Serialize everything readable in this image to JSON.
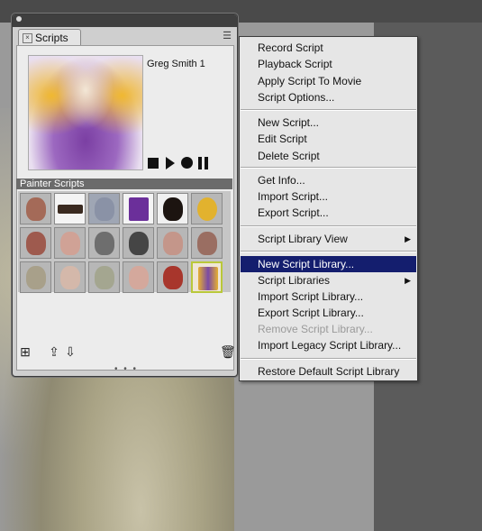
{
  "panel": {
    "tab_label": "Scripts",
    "close_glyph": "×",
    "menu_glyph": "☰",
    "preview_name": "Greg Smith 1",
    "library_header": "Painter Scripts",
    "bottom_glyphs": {
      "new_script": "⊞",
      "import": "⇪",
      "export": "⇩",
      "delete": "🗑"
    },
    "resize_dots": "• • •"
  },
  "menu": {
    "items": [
      {
        "label": "Record Script",
        "enabled": true
      },
      {
        "label": "Playback Script",
        "enabled": true
      },
      {
        "label": "Apply Script To Movie",
        "enabled": true
      },
      {
        "label": "Script Options...",
        "enabled": true
      },
      {
        "label": "New Script...",
        "enabled": true
      },
      {
        "label": "Edit Script",
        "enabled": true
      },
      {
        "label": "Delete Script",
        "enabled": true
      },
      {
        "label": "Get Info...",
        "enabled": true
      },
      {
        "label": "Import Script...",
        "enabled": true
      },
      {
        "label": "Export Script...",
        "enabled": true
      },
      {
        "label": "Script Library View",
        "enabled": true,
        "submenu": true
      },
      {
        "label": "New Script Library...",
        "enabled": true,
        "highlighted": true
      },
      {
        "label": "Script Libraries",
        "enabled": true,
        "submenu": true
      },
      {
        "label": "Import Script Library...",
        "enabled": true
      },
      {
        "label": "Export Script Library...",
        "enabled": true
      },
      {
        "label": "Remove Script Library...",
        "enabled": false
      },
      {
        "label": "Import Legacy Script Library...",
        "enabled": true
      },
      {
        "label": "Restore Default Script Library",
        "enabled": true
      }
    ],
    "submenu_arrow": "▶"
  },
  "colors": {
    "highlight": "#141e6e",
    "selected_thumb_border": "#b9c83a"
  }
}
